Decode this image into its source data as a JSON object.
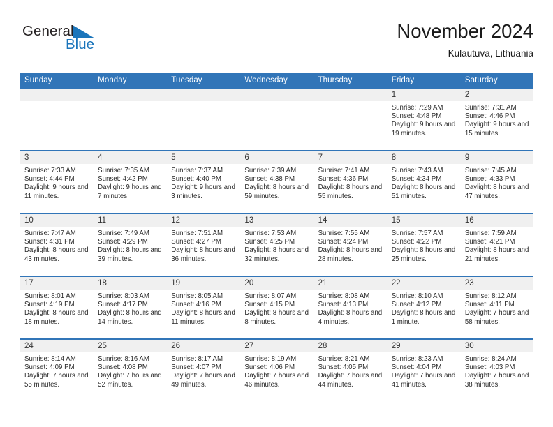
{
  "brand": {
    "name_part1": "General",
    "name_part2": "Blue",
    "triangle_icon": "triangle-logo-icon",
    "color_primary": "#1b75bb",
    "color_text": "#231f20"
  },
  "header": {
    "title": "November 2024",
    "subtitle": "Kulautuva, Lithuania"
  },
  "theme": {
    "header_band": "#3175b8",
    "daynum_band": "#f0f0f0",
    "cell_background": "#ffffff",
    "text": "#2b2b2b"
  },
  "weekday_headers": [
    "Sunday",
    "Monday",
    "Tuesday",
    "Wednesday",
    "Thursday",
    "Friday",
    "Saturday"
  ],
  "weeks": [
    [
      {
        "day": "",
        "empty": true
      },
      {
        "day": "",
        "empty": true
      },
      {
        "day": "",
        "empty": true
      },
      {
        "day": "",
        "empty": true
      },
      {
        "day": "",
        "empty": true
      },
      {
        "day": "1",
        "sunrise": "Sunrise: 7:29 AM",
        "sunset": "Sunset: 4:48 PM",
        "daylight": "Daylight: 9 hours and 19 minutes."
      },
      {
        "day": "2",
        "sunrise": "Sunrise: 7:31 AM",
        "sunset": "Sunset: 4:46 PM",
        "daylight": "Daylight: 9 hours and 15 minutes."
      }
    ],
    [
      {
        "day": "3",
        "sunrise": "Sunrise: 7:33 AM",
        "sunset": "Sunset: 4:44 PM",
        "daylight": "Daylight: 9 hours and 11 minutes."
      },
      {
        "day": "4",
        "sunrise": "Sunrise: 7:35 AM",
        "sunset": "Sunset: 4:42 PM",
        "daylight": "Daylight: 9 hours and 7 minutes."
      },
      {
        "day": "5",
        "sunrise": "Sunrise: 7:37 AM",
        "sunset": "Sunset: 4:40 PM",
        "daylight": "Daylight: 9 hours and 3 minutes."
      },
      {
        "day": "6",
        "sunrise": "Sunrise: 7:39 AM",
        "sunset": "Sunset: 4:38 PM",
        "daylight": "Daylight: 8 hours and 59 minutes."
      },
      {
        "day": "7",
        "sunrise": "Sunrise: 7:41 AM",
        "sunset": "Sunset: 4:36 PM",
        "daylight": "Daylight: 8 hours and 55 minutes."
      },
      {
        "day": "8",
        "sunrise": "Sunrise: 7:43 AM",
        "sunset": "Sunset: 4:34 PM",
        "daylight": "Daylight: 8 hours and 51 minutes."
      },
      {
        "day": "9",
        "sunrise": "Sunrise: 7:45 AM",
        "sunset": "Sunset: 4:33 PM",
        "daylight": "Daylight: 8 hours and 47 minutes."
      }
    ],
    [
      {
        "day": "10",
        "sunrise": "Sunrise: 7:47 AM",
        "sunset": "Sunset: 4:31 PM",
        "daylight": "Daylight: 8 hours and 43 minutes."
      },
      {
        "day": "11",
        "sunrise": "Sunrise: 7:49 AM",
        "sunset": "Sunset: 4:29 PM",
        "daylight": "Daylight: 8 hours and 39 minutes."
      },
      {
        "day": "12",
        "sunrise": "Sunrise: 7:51 AM",
        "sunset": "Sunset: 4:27 PM",
        "daylight": "Daylight: 8 hours and 36 minutes."
      },
      {
        "day": "13",
        "sunrise": "Sunrise: 7:53 AM",
        "sunset": "Sunset: 4:25 PM",
        "daylight": "Daylight: 8 hours and 32 minutes."
      },
      {
        "day": "14",
        "sunrise": "Sunrise: 7:55 AM",
        "sunset": "Sunset: 4:24 PM",
        "daylight": "Daylight: 8 hours and 28 minutes."
      },
      {
        "day": "15",
        "sunrise": "Sunrise: 7:57 AM",
        "sunset": "Sunset: 4:22 PM",
        "daylight": "Daylight: 8 hours and 25 minutes."
      },
      {
        "day": "16",
        "sunrise": "Sunrise: 7:59 AM",
        "sunset": "Sunset: 4:21 PM",
        "daylight": "Daylight: 8 hours and 21 minutes."
      }
    ],
    [
      {
        "day": "17",
        "sunrise": "Sunrise: 8:01 AM",
        "sunset": "Sunset: 4:19 PM",
        "daylight": "Daylight: 8 hours and 18 minutes."
      },
      {
        "day": "18",
        "sunrise": "Sunrise: 8:03 AM",
        "sunset": "Sunset: 4:17 PM",
        "daylight": "Daylight: 8 hours and 14 minutes."
      },
      {
        "day": "19",
        "sunrise": "Sunrise: 8:05 AM",
        "sunset": "Sunset: 4:16 PM",
        "daylight": "Daylight: 8 hours and 11 minutes."
      },
      {
        "day": "20",
        "sunrise": "Sunrise: 8:07 AM",
        "sunset": "Sunset: 4:15 PM",
        "daylight": "Daylight: 8 hours and 8 minutes."
      },
      {
        "day": "21",
        "sunrise": "Sunrise: 8:08 AM",
        "sunset": "Sunset: 4:13 PM",
        "daylight": "Daylight: 8 hours and 4 minutes."
      },
      {
        "day": "22",
        "sunrise": "Sunrise: 8:10 AM",
        "sunset": "Sunset: 4:12 PM",
        "daylight": "Daylight: 8 hours and 1 minute."
      },
      {
        "day": "23",
        "sunrise": "Sunrise: 8:12 AM",
        "sunset": "Sunset: 4:11 PM",
        "daylight": "Daylight: 7 hours and 58 minutes."
      }
    ],
    [
      {
        "day": "24",
        "sunrise": "Sunrise: 8:14 AM",
        "sunset": "Sunset: 4:09 PM",
        "daylight": "Daylight: 7 hours and 55 minutes."
      },
      {
        "day": "25",
        "sunrise": "Sunrise: 8:16 AM",
        "sunset": "Sunset: 4:08 PM",
        "daylight": "Daylight: 7 hours and 52 minutes."
      },
      {
        "day": "26",
        "sunrise": "Sunrise: 8:17 AM",
        "sunset": "Sunset: 4:07 PM",
        "daylight": "Daylight: 7 hours and 49 minutes."
      },
      {
        "day": "27",
        "sunrise": "Sunrise: 8:19 AM",
        "sunset": "Sunset: 4:06 PM",
        "daylight": "Daylight: 7 hours and 46 minutes."
      },
      {
        "day": "28",
        "sunrise": "Sunrise: 8:21 AM",
        "sunset": "Sunset: 4:05 PM",
        "daylight": "Daylight: 7 hours and 44 minutes."
      },
      {
        "day": "29",
        "sunrise": "Sunrise: 8:23 AM",
        "sunset": "Sunset: 4:04 PM",
        "daylight": "Daylight: 7 hours and 41 minutes."
      },
      {
        "day": "30",
        "sunrise": "Sunrise: 8:24 AM",
        "sunset": "Sunset: 4:03 PM",
        "daylight": "Daylight: 7 hours and 38 minutes."
      }
    ]
  ]
}
